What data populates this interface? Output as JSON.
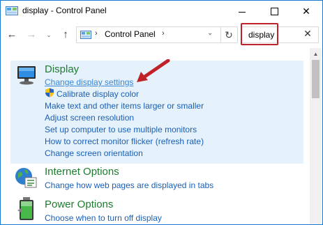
{
  "window": {
    "title": "display - Control Panel",
    "icon": "control-panel-icon"
  },
  "titlebar": {
    "minimize": "minimize",
    "maximize": "maximize",
    "close": "✕"
  },
  "nav": {
    "back": "←",
    "forward": "→",
    "recent": "⌄",
    "up": "↑",
    "address_root_sep": "›",
    "address": "Control Panel",
    "address_sep": "›",
    "address_dropdown": "⌄",
    "refresh": "↻"
  },
  "search": {
    "value": "display",
    "clear": "✕"
  },
  "categories": [
    {
      "title": "Display",
      "icon": "monitor-icon",
      "links": [
        "Change display settings",
        "Calibrate display color",
        "Make text and other items larger or smaller",
        "Adjust screen resolution",
        "Set up computer to use multiple monitors",
        "How to correct monitor flicker (refresh rate)",
        "Change screen orientation"
      ]
    },
    {
      "title": "Internet Options",
      "icon": "internet-options-icon",
      "links": [
        "Change how web pages are displayed in tabs"
      ]
    },
    {
      "title": "Power Options",
      "icon": "battery-icon",
      "links": [
        "Choose when to turn off display"
      ]
    }
  ],
  "colors": {
    "accent": "#1a5fb4",
    "title_green": "#1e7b2f",
    "selection": "#e5f1fb",
    "annotation": "#c0222a"
  }
}
